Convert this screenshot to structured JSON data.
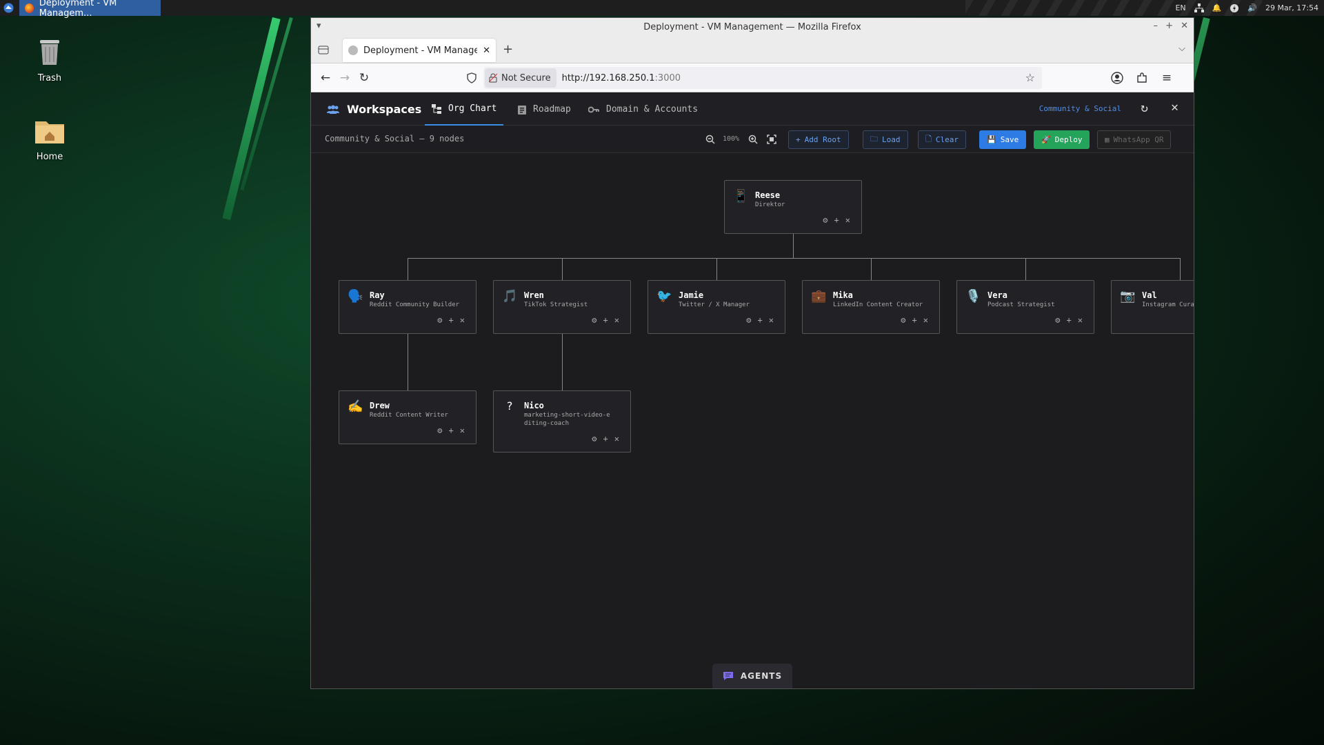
{
  "taskbar": {
    "window_title": "Deployment - VM Managem...",
    "lang": "EN",
    "datetime": "29 Mar, 17:54"
  },
  "desktop": {
    "icons": [
      {
        "label": "Trash",
        "icon": "trash-icon"
      },
      {
        "label": "Home",
        "icon": "home-folder-icon"
      }
    ]
  },
  "browser": {
    "window_title": "Deployment - VM Management — Mozilla Firefox",
    "tab_title": "Deployment - VM Management",
    "security_label": "Not Secure",
    "url_host": "http://192.168.250.1",
    "url_port": ":3000"
  },
  "app": {
    "brand": "Workspaces",
    "tabs": [
      {
        "label": "Org Chart",
        "icon": "org-chart-icon",
        "active": true
      },
      {
        "label": "Roadmap",
        "icon": "clipboard-icon",
        "active": false
      },
      {
        "label": "Domain & Accounts",
        "icon": "key-icon",
        "active": false
      }
    ],
    "workspace_link": "Community & Social",
    "breadcrumb": "Community & Social — 9 nodes",
    "zoom_level": "100%",
    "buttons": {
      "add_root": "Add Root",
      "load": "Load",
      "clear": "Clear",
      "save": "Save",
      "deploy": "Deploy",
      "whatsapp": "WhatsApp QR"
    },
    "agents_label": "AGENTS"
  },
  "nodes": [
    {
      "id": "reese",
      "name": "Reese",
      "role": "Direktor",
      "emoji": "📱"
    },
    {
      "id": "ray",
      "name": "Ray",
      "role": "Reddit Community Builder",
      "emoji": "🗣️"
    },
    {
      "id": "wren",
      "name": "Wren",
      "role": "TikTok Strategist",
      "emoji": "🎵"
    },
    {
      "id": "jamie",
      "name": "Jamie",
      "role": "Twitter / X Manager",
      "emoji": "🐦"
    },
    {
      "id": "mika",
      "name": "Mika",
      "role": "LinkedIn Content Creator",
      "emoji": "💼"
    },
    {
      "id": "vera",
      "name": "Vera",
      "role": "Podcast Strategist",
      "emoji": "🎙️"
    },
    {
      "id": "val",
      "name": "Val",
      "role": "Instagram Curator",
      "emoji": "📷"
    },
    {
      "id": "drew",
      "name": "Drew",
      "role": "Reddit Content Writer",
      "emoji": "✍️"
    },
    {
      "id": "nico",
      "name": "Nico",
      "role": "marketing-short-video-editing-coach",
      "emoji": "?"
    }
  ],
  "colors": {
    "accent": "#3a8ee6",
    "save": "#2d7be5",
    "deploy": "#24a35a"
  }
}
